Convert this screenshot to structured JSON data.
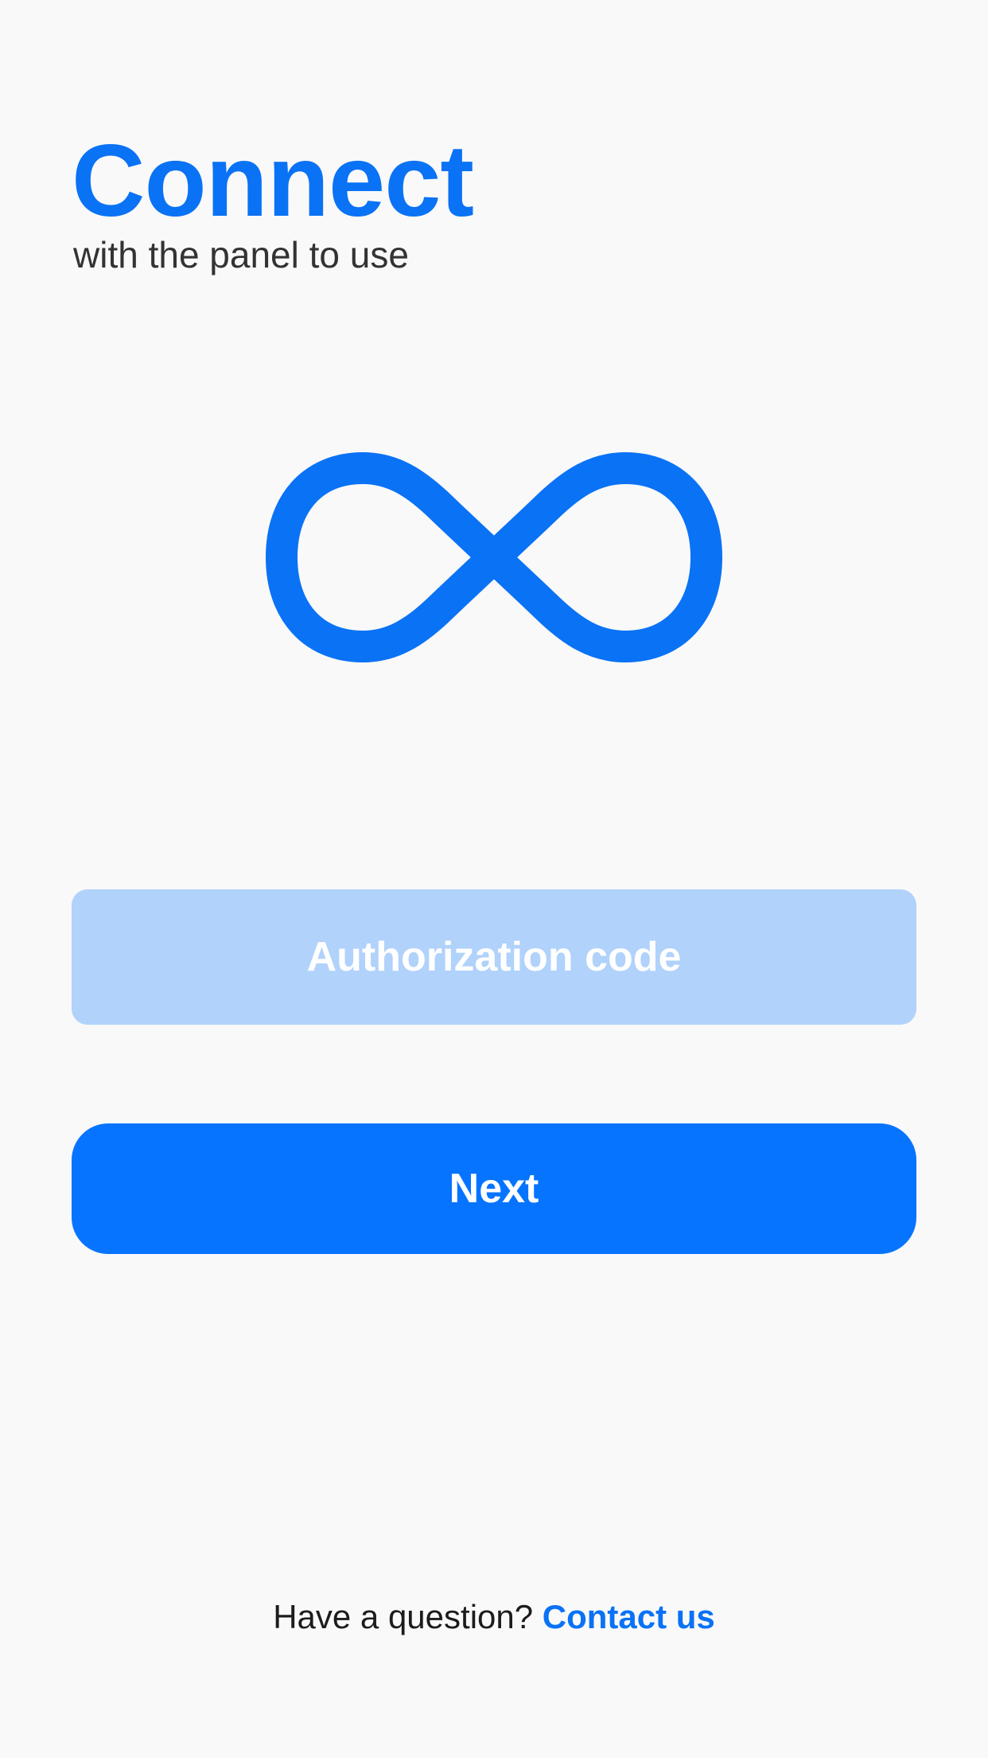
{
  "header": {
    "title": "Connect",
    "subtitle": "with the panel to use"
  },
  "logo": {
    "icon": "infinity-icon",
    "color": "#0a72f5"
  },
  "auth": {
    "placeholder": "Authorization code",
    "value": ""
  },
  "actions": {
    "next_label": "Next"
  },
  "footer": {
    "question": "Have a question?",
    "contact_label": "Contact us"
  },
  "colors": {
    "accent": "#0a72f5",
    "field_background": "#b0d2fb",
    "button_background": "#0774ff",
    "page_background": "#f9f9f9"
  }
}
